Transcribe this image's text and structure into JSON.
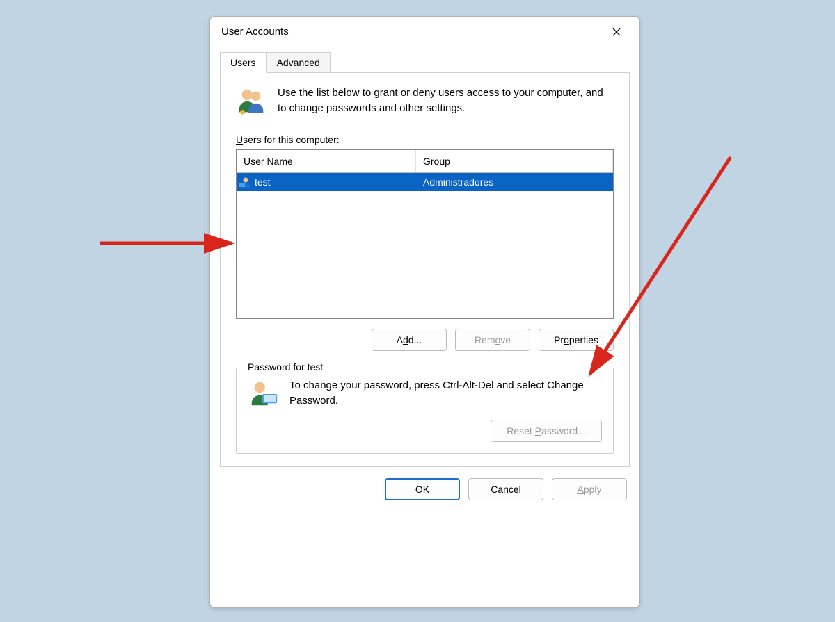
{
  "window": {
    "title": "User Accounts"
  },
  "tabs": {
    "users": "Users",
    "advanced": "Advanced"
  },
  "intro": "Use the list below to grant or deny users access to your computer, and to change passwords and other settings.",
  "usersLabel": {
    "pre": "U",
    "rest": "sers for this computer:"
  },
  "columns": {
    "name": "User Name",
    "group": "Group"
  },
  "rows": [
    {
      "name": "test",
      "group": "Administradores",
      "selected": true
    }
  ],
  "buttons": {
    "add": {
      "pre": "A",
      "ul": "d",
      "post": "d..."
    },
    "remove": {
      "pre": "Rem",
      "ul": "o",
      "post": "ve"
    },
    "properties": {
      "pre": "Pr",
      "ul": "o",
      "post": "perties"
    }
  },
  "passwordBox": {
    "legend": "Password for test",
    "text": "To change your password, press Ctrl-Alt-Del and select Change Password.",
    "reset": {
      "pre": "Reset ",
      "ul": "P",
      "post": "assword..."
    }
  },
  "dialogButtons": {
    "ok": "OK",
    "cancel": "Cancel",
    "apply": {
      "pre": "",
      "ul": "A",
      "post": "pply"
    }
  }
}
